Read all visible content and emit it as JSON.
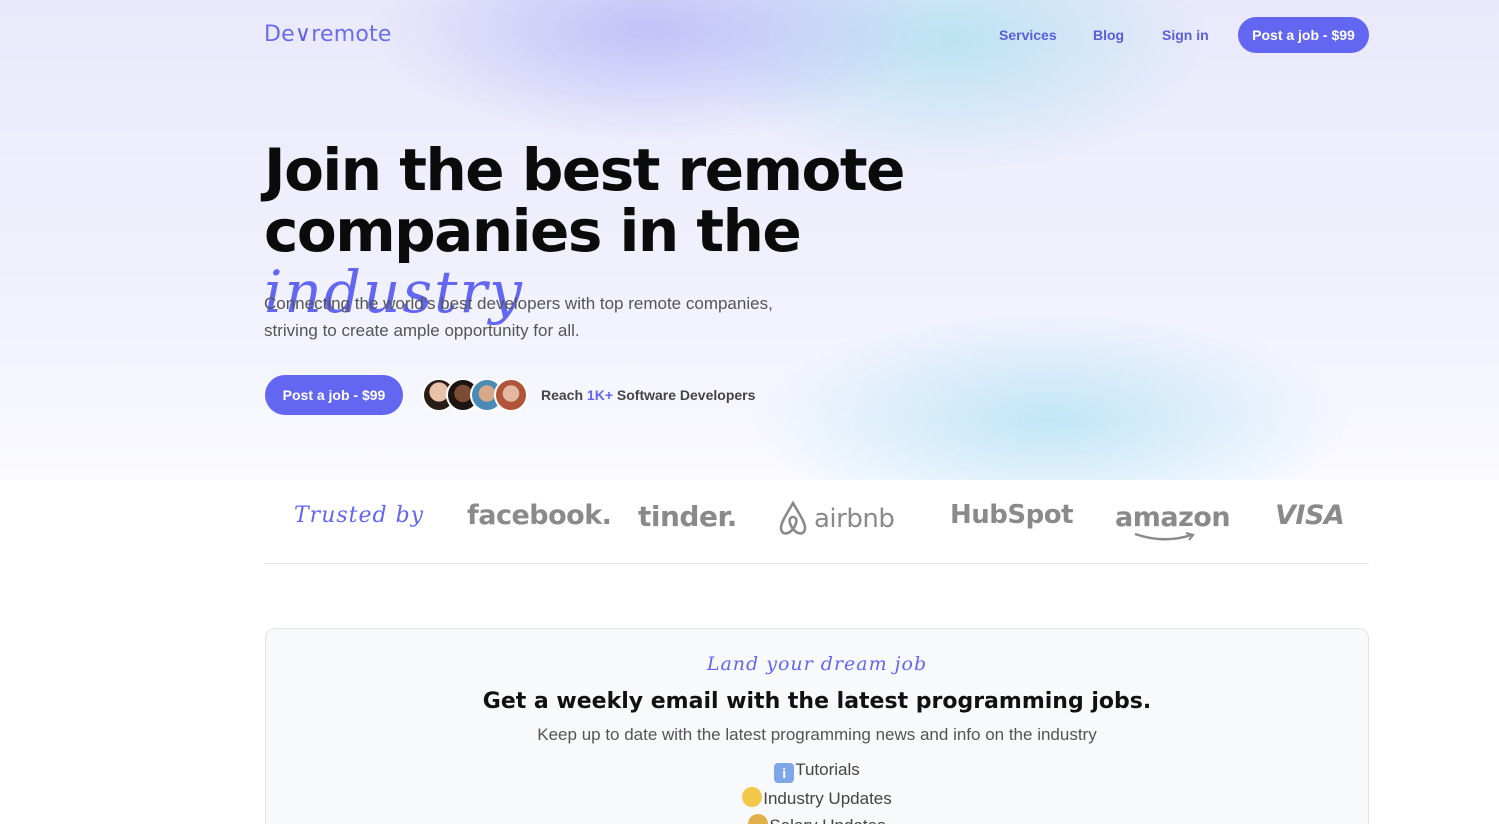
{
  "header": {
    "logo_text": "Devremote",
    "logo_prefix": "De",
    "logo_suffix": "remote",
    "nav": [
      "Services",
      "Blog",
      "Sign in"
    ],
    "cta": "Post a job - $99"
  },
  "hero": {
    "headline_line1": "Join the best remote",
    "headline_line2": "companies in the",
    "headline_script": "industry",
    "subtext": "Connecting the world's best developers with top remote companies, striving to create ample opportunity for all.",
    "cta": "Post a job - $99",
    "reach_prefix": "Reach",
    "reach_count": "1K+",
    "reach_suffix": "Software Developers"
  },
  "trusted": {
    "label": "Trusted by",
    "brands": [
      "facebook.",
      "tinder.",
      "airbnb",
      "HubSpot",
      "amazon",
      "VISA"
    ]
  },
  "newsletter": {
    "kicker": "Land your dream job",
    "title": "Get a weekly email with the latest programming jobs.",
    "subtitle": "Keep up to date with the latest programming news and info on the industry",
    "perks": [
      "Tutorials",
      "Industry Updates",
      "Salary Updates"
    ]
  },
  "colors": {
    "accent": "#6366f1",
    "brand_gray": "#8a8a8a"
  }
}
